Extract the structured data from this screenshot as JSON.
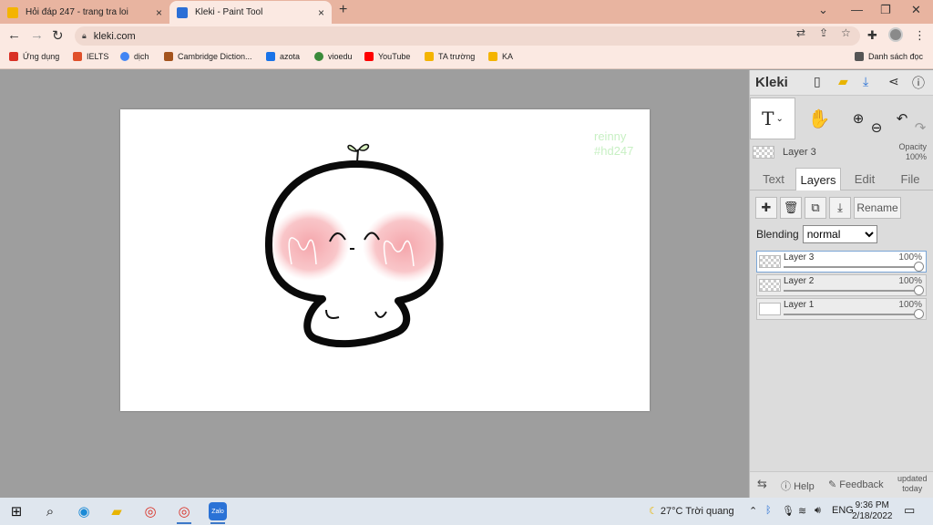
{
  "browser": {
    "tabs": [
      {
        "title": "Hỏi đáp 247 - trang tra loi",
        "close": "×"
      },
      {
        "title": "Kleki - Paint Tool",
        "close": "×"
      }
    ],
    "new_tab": "+",
    "window_controls": {
      "collapse": "⌄",
      "minimize": "—",
      "restore": "❐",
      "close": "✕"
    },
    "url": "kleki.com",
    "bookmarks": [
      {
        "label": "Ứng dụng",
        "color": "#d93025"
      },
      {
        "label": "IELTS",
        "color": "#e0502a"
      },
      {
        "label": "dịch",
        "color": "#4285f4"
      },
      {
        "label": "Cambridge Diction...",
        "color": "#a4541e"
      },
      {
        "label": "azota",
        "color": "#1a73e8"
      },
      {
        "label": "vioedu",
        "color": "#3a8a3a"
      },
      {
        "label": "YouTube",
        "color": "#ff0000"
      },
      {
        "label": "TA trường",
        "color": "#f4b400"
      },
      {
        "label": "KA",
        "color": "#f4b400"
      }
    ],
    "reading_list": "Danh sách đọc"
  },
  "canvas": {
    "watermark_line1": "reinny",
    "watermark_line2": "#hd247"
  },
  "kleki": {
    "logo": "Kleki",
    "tool_text_glyph": "T",
    "layer_name": "Layer 3",
    "opacity_label": "Opacity",
    "opacity_value": "100%",
    "tabs": [
      "Text",
      "Layers",
      "Edit",
      "File"
    ],
    "rename": "Rename",
    "blending_label": "Blending",
    "blending_value": "normal",
    "layers": [
      {
        "name": "Layer 3",
        "opacity": "100%",
        "selected": true
      },
      {
        "name": "Layer 2",
        "opacity": "100%",
        "selected": false
      },
      {
        "name": "Layer 1",
        "opacity": "100%",
        "selected": false
      }
    ],
    "help": "Help",
    "feedback": "Feedback",
    "updated_line1": "updated",
    "updated_line2": "today"
  },
  "taskbar": {
    "weather": "27°C  Trời quang",
    "language": "ENG",
    "time": "9:36 PM",
    "date": "2/18/2022"
  }
}
